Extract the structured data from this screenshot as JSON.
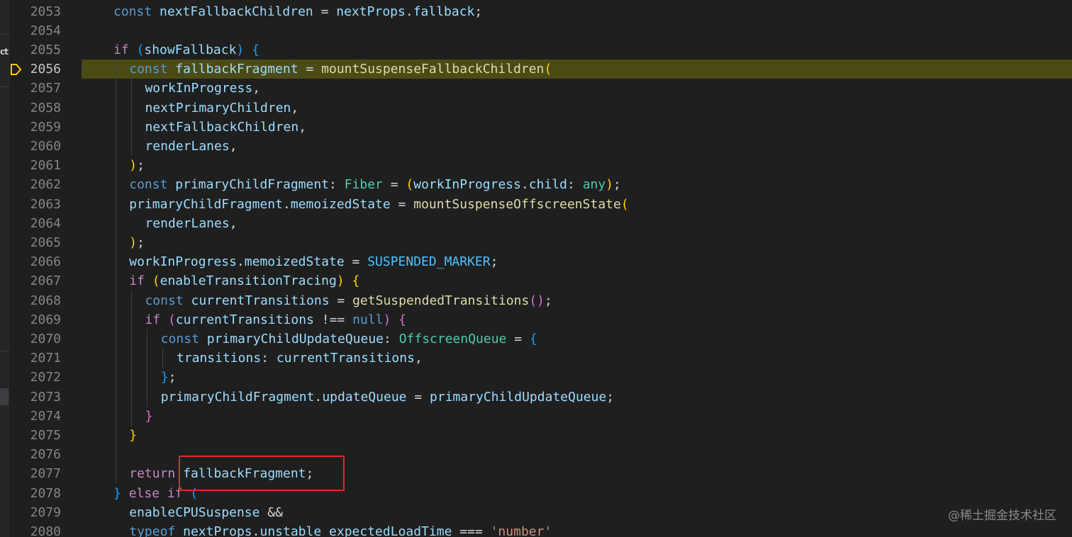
{
  "lines": [
    {
      "no": "2053",
      "tokens": [
        {
          "t": "const",
          "c": "kw"
        },
        {
          "t": " "
        },
        {
          "t": "nextFallbackChildren",
          "c": "var"
        },
        {
          "t": " = "
        },
        {
          "t": "nextProps",
          "c": "var"
        },
        {
          "t": "."
        },
        {
          "t": "fallback",
          "c": "var"
        },
        {
          "t": ";"
        }
      ]
    },
    {
      "no": "2054",
      "tokens": []
    },
    {
      "no": "2055",
      "tokens": [
        {
          "t": "if",
          "c": "ctl"
        },
        {
          "t": " "
        },
        {
          "t": "(",
          "c": "p3"
        },
        {
          "t": "showFallback",
          "c": "var"
        },
        {
          "t": ")",
          "c": "p3"
        },
        {
          "t": " "
        },
        {
          "t": "{",
          "c": "p3"
        }
      ]
    },
    {
      "no": "2056",
      "tokens": [
        {
          "t": "const",
          "c": "kw"
        },
        {
          "t": " "
        },
        {
          "t": "fallbackFragment",
          "c": "var"
        },
        {
          "t": " = "
        },
        {
          "t": "mountSuspenseFallbackChildren",
          "c": "fn"
        },
        {
          "t": "(",
          "c": "p1"
        }
      ]
    },
    {
      "no": "2057",
      "tokens": [
        {
          "t": "workInProgress",
          "c": "var"
        },
        {
          "t": ","
        }
      ]
    },
    {
      "no": "2058",
      "tokens": [
        {
          "t": "nextPrimaryChildren",
          "c": "var"
        },
        {
          "t": ","
        }
      ]
    },
    {
      "no": "2059",
      "tokens": [
        {
          "t": "nextFallbackChildren",
          "c": "var"
        },
        {
          "t": ","
        }
      ]
    },
    {
      "no": "2060",
      "tokens": [
        {
          "t": "renderLanes",
          "c": "var"
        },
        {
          "t": ","
        }
      ]
    },
    {
      "no": "2061",
      "tokens": [
        {
          "t": ")",
          "c": "p1"
        },
        {
          "t": ";"
        }
      ]
    },
    {
      "no": "2062",
      "tokens": [
        {
          "t": "const",
          "c": "kw"
        },
        {
          "t": " "
        },
        {
          "t": "primaryChildFragment",
          "c": "var"
        },
        {
          "t": ": "
        },
        {
          "t": "Fiber",
          "c": "ty"
        },
        {
          "t": " = "
        },
        {
          "t": "(",
          "c": "p1"
        },
        {
          "t": "workInProgress",
          "c": "var"
        },
        {
          "t": "."
        },
        {
          "t": "child",
          "c": "var"
        },
        {
          "t": ": "
        },
        {
          "t": "any",
          "c": "ty"
        },
        {
          "t": ")",
          "c": "p1"
        },
        {
          "t": ";"
        }
      ]
    },
    {
      "no": "2063",
      "tokens": [
        {
          "t": "primaryChildFragment",
          "c": "var"
        },
        {
          "t": "."
        },
        {
          "t": "memoizedState",
          "c": "var"
        },
        {
          "t": " = "
        },
        {
          "t": "mountSuspenseOffscreenState",
          "c": "fn"
        },
        {
          "t": "(",
          "c": "p1"
        }
      ]
    },
    {
      "no": "2064",
      "tokens": [
        {
          "t": "renderLanes",
          "c": "var"
        },
        {
          "t": ","
        }
      ]
    },
    {
      "no": "2065",
      "tokens": [
        {
          "t": ")",
          "c": "p1"
        },
        {
          "t": ";"
        }
      ]
    },
    {
      "no": "2066",
      "tokens": [
        {
          "t": "workInProgress",
          "c": "var"
        },
        {
          "t": "."
        },
        {
          "t": "memoizedState",
          "c": "var"
        },
        {
          "t": " = "
        },
        {
          "t": "SUSPENDED_MARKER",
          "c": "cn"
        },
        {
          "t": ";"
        }
      ]
    },
    {
      "no": "2067",
      "tokens": [
        {
          "t": "if",
          "c": "ctl"
        },
        {
          "t": " "
        },
        {
          "t": "(",
          "c": "p1"
        },
        {
          "t": "enableTransitionTracing",
          "c": "var"
        },
        {
          "t": ")",
          "c": "p1"
        },
        {
          "t": " "
        },
        {
          "t": "{",
          "c": "p1"
        }
      ]
    },
    {
      "no": "2068",
      "tokens": [
        {
          "t": "const",
          "c": "kw"
        },
        {
          "t": " "
        },
        {
          "t": "currentTransitions",
          "c": "var"
        },
        {
          "t": " = "
        },
        {
          "t": "getSuspendedTransitions",
          "c": "fn"
        },
        {
          "t": "()",
          "c": "p2"
        },
        {
          "t": ";"
        }
      ]
    },
    {
      "no": "2069",
      "tokens": [
        {
          "t": "if",
          "c": "ctl"
        },
        {
          "t": " "
        },
        {
          "t": "(",
          "c": "p2"
        },
        {
          "t": "currentTransitions",
          "c": "var"
        },
        {
          "t": " !== "
        },
        {
          "t": "null",
          "c": "kw"
        },
        {
          "t": ")",
          "c": "p2"
        },
        {
          "t": " "
        },
        {
          "t": "{",
          "c": "p2"
        }
      ]
    },
    {
      "no": "2070",
      "tokens": [
        {
          "t": "const",
          "c": "kw"
        },
        {
          "t": " "
        },
        {
          "t": "primaryChildUpdateQueue",
          "c": "var"
        },
        {
          "t": ": "
        },
        {
          "t": "OffscreenQueue",
          "c": "ty"
        },
        {
          "t": " = "
        },
        {
          "t": "{",
          "c": "p3"
        }
      ]
    },
    {
      "no": "2071",
      "tokens": [
        {
          "t": "transitions",
          "c": "var"
        },
        {
          "t": ": "
        },
        {
          "t": "currentTransitions",
          "c": "var"
        },
        {
          "t": ","
        }
      ]
    },
    {
      "no": "2072",
      "tokens": [
        {
          "t": "}",
          "c": "p3"
        },
        {
          "t": ";"
        }
      ]
    },
    {
      "no": "2073",
      "tokens": [
        {
          "t": "primaryChildFragment",
          "c": "var"
        },
        {
          "t": "."
        },
        {
          "t": "updateQueue",
          "c": "var"
        },
        {
          "t": " = "
        },
        {
          "t": "primaryChildUpdateQueue",
          "c": "var"
        },
        {
          "t": ";"
        }
      ]
    },
    {
      "no": "2074",
      "tokens": [
        {
          "t": "}",
          "c": "p2"
        }
      ]
    },
    {
      "no": "2075",
      "tokens": [
        {
          "t": "}",
          "c": "p1"
        }
      ]
    },
    {
      "no": "2076",
      "tokens": []
    },
    {
      "no": "2077",
      "tokens": [
        {
          "t": "return",
          "c": "ctl"
        },
        {
          "t": " "
        },
        {
          "t": "fallbackFragment",
          "c": "var"
        },
        {
          "t": ";"
        }
      ]
    },
    {
      "no": "2078",
      "tokens": [
        {
          "t": "}",
          "c": "p3"
        },
        {
          "t": " "
        },
        {
          "t": "else",
          "c": "ctl"
        },
        {
          "t": " "
        },
        {
          "t": "if",
          "c": "ctl"
        },
        {
          "t": " "
        },
        {
          "t": "(",
          "c": "p3"
        }
      ]
    },
    {
      "no": "2079",
      "tokens": [
        {
          "t": "enableCPUSuspense",
          "c": "var"
        },
        {
          "t": " && "
        }
      ]
    },
    {
      "no": "2080",
      "tokens": [
        {
          "t": "typeof",
          "c": "kw"
        },
        {
          "t": " "
        },
        {
          "t": "nextProps",
          "c": "var"
        },
        {
          "t": "."
        },
        {
          "t": "unstable_expectedLoadTime",
          "c": "var"
        },
        {
          "t": " === "
        },
        {
          "t": "'number'",
          "c": "str"
        }
      ]
    }
  ],
  "sidebar_fragment": "ct",
  "watermark": "@稀土掘金技术社区"
}
